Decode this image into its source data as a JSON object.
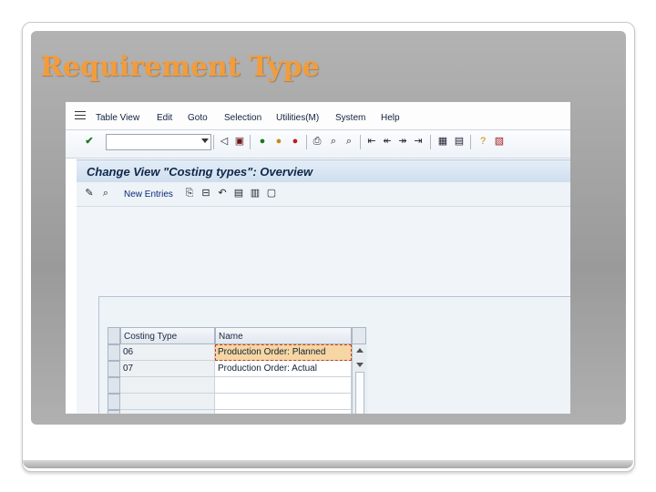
{
  "slide": {
    "title": "Requirement Type"
  },
  "menu": {
    "items": [
      {
        "label": "Table View"
      },
      {
        "label": "Edit"
      },
      {
        "label": "Goto"
      },
      {
        "label": "Selection"
      },
      {
        "label": "Utilities(M)"
      },
      {
        "label": "System"
      },
      {
        "label": "Help"
      }
    ]
  },
  "toolbar": {
    "command_field_value": "",
    "icons": [
      "enter-icon",
      "back-icon",
      "save-icon",
      "exit-icon",
      "cancel-icon",
      "print-icon",
      "find-icon",
      "find-next-icon",
      "first-page-icon",
      "previous-page-icon",
      "next-page-icon",
      "last-page-icon",
      "create-session-icon",
      "shortcut-icon",
      "help-icon",
      "layout-menu-icon"
    ]
  },
  "screen": {
    "title": "Change View \"Costing types\": Overview"
  },
  "app_toolbar": {
    "new_entries_label": "New Entries"
  },
  "table": {
    "columns": [
      "Costing Type",
      "Name"
    ],
    "rows": [
      {
        "costing_type": "06",
        "name": "Production Order: Planned"
      },
      {
        "costing_type": "07",
        "name": "Production Order: Actual"
      }
    ]
  },
  "colors": {
    "title_accent": "#f39c3c",
    "selection": "#f6d6a2",
    "sap_title_text": "#0f2849"
  }
}
